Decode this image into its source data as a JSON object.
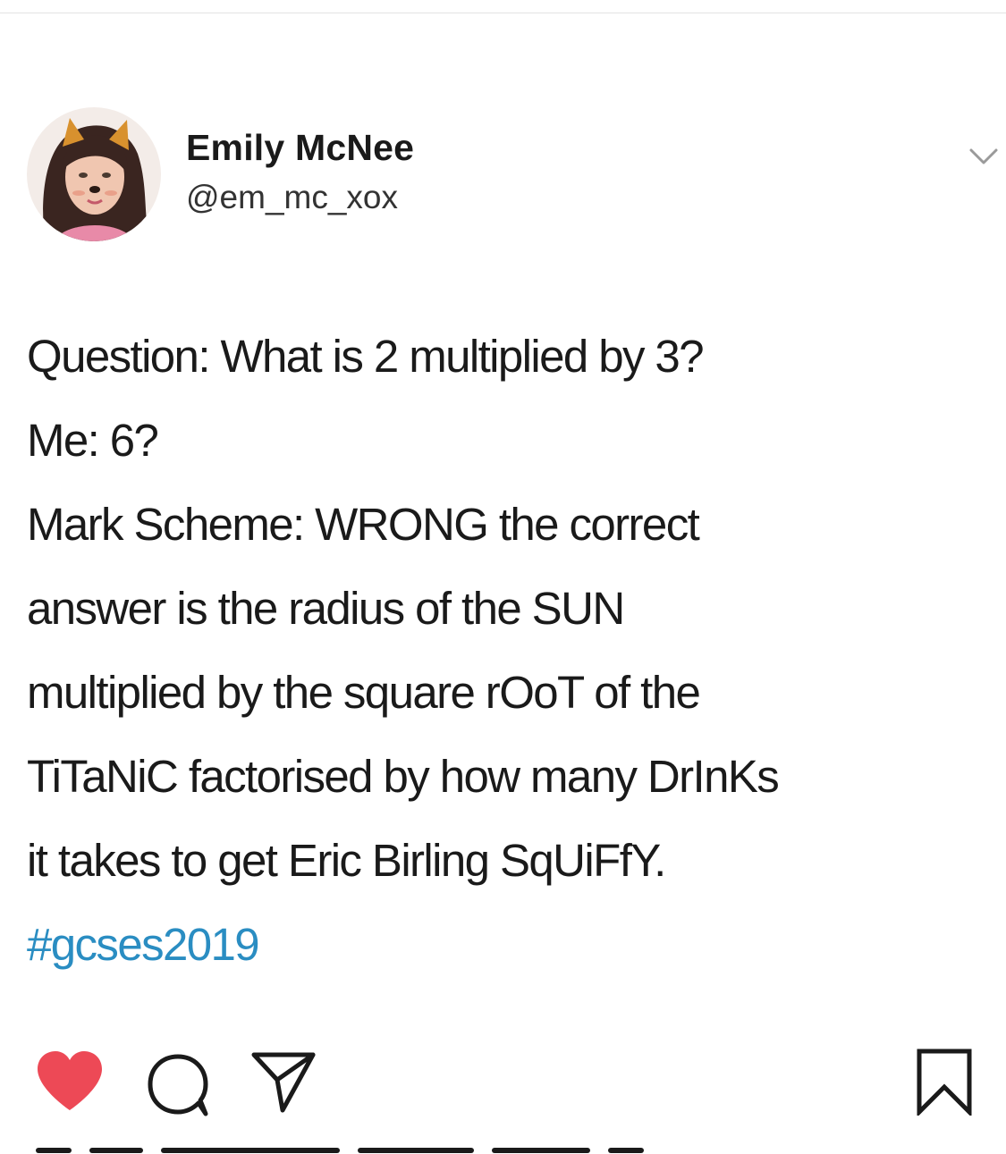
{
  "author": {
    "name": "Emily McNee",
    "handle": "@em_mc_xox"
  },
  "tweet": {
    "lines": [
      "Question: What is 2 multiplied by 3?",
      "Me: 6?",
      "Mark Scheme: WRONG the correct",
      "answer is the radius of the SUN",
      "multiplied by the square rOoT of the",
      "TiTaNiC factorised by how many DrInKs",
      "it takes to get Eric Birling SqUiFfY."
    ],
    "hashtag": "#gcses2019"
  },
  "colors": {
    "hashtag": "#2a8dc2",
    "like_heart": "#ed4956",
    "text": "#1a1a1a"
  },
  "icons": {
    "menu": "chevron-down-icon",
    "like": "heart-filled-icon",
    "comment": "comment-bubble-icon",
    "share": "paper-plane-icon",
    "save": "bookmark-icon"
  },
  "actions": {
    "liked": true
  }
}
